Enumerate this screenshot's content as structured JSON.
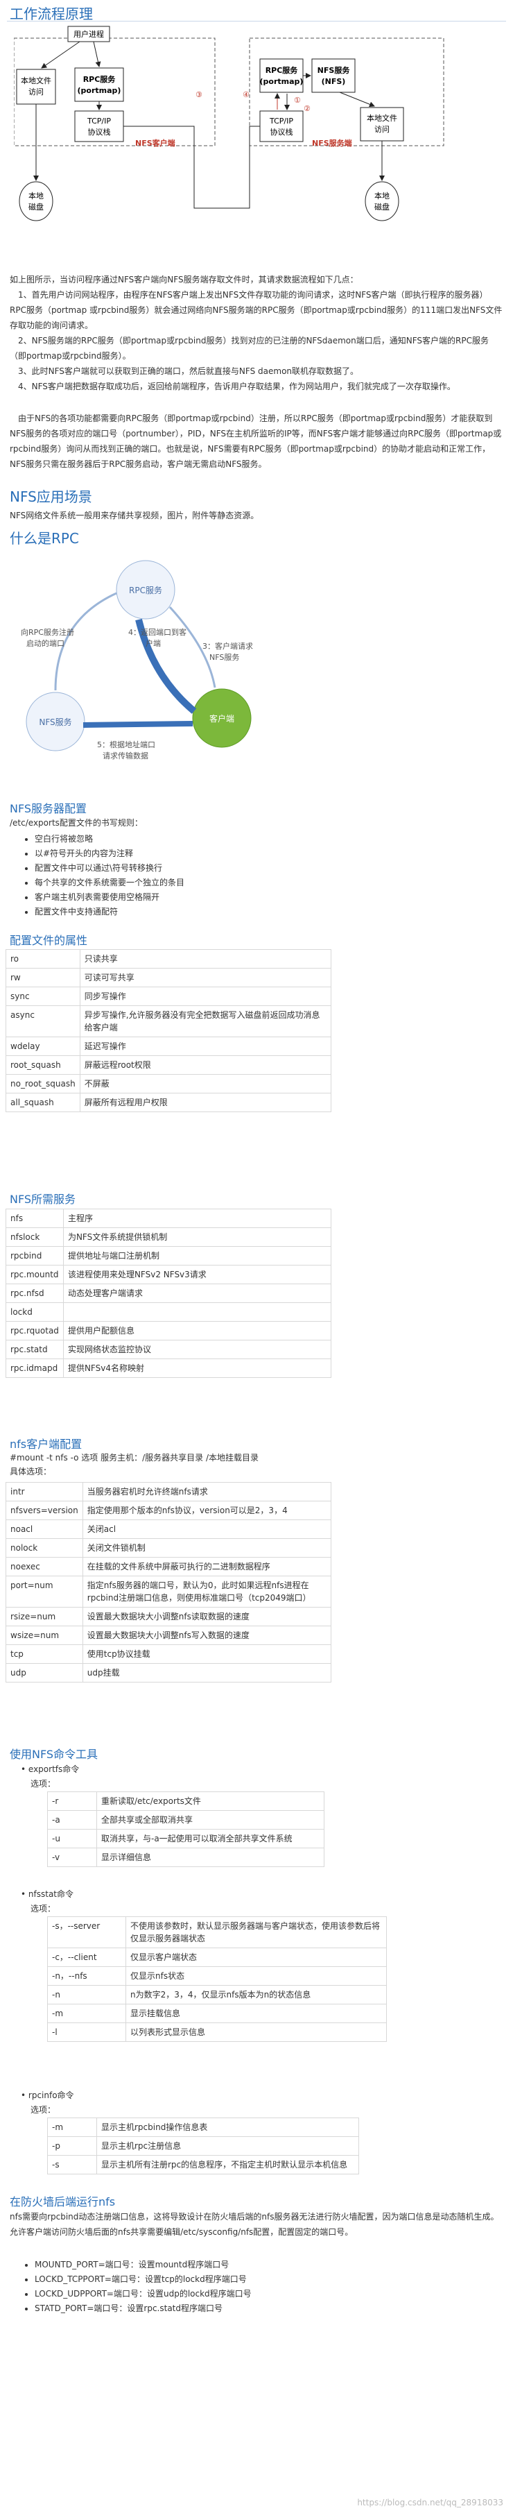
{
  "s1_title": "工作流程原理",
  "diagram": {
    "user_process": "用户进程",
    "local_fs1": "本地文件",
    "local_fs2": "访问",
    "rpc_left1": "RPC服务",
    "rpc_left2": "(portmap)",
    "tcpip_left1": "TCP/IP",
    "tcpip_left2": "协议栈",
    "client_label": "NFS客户端",
    "rpc_right1": "RPC服务",
    "rpc_right2": "(portmap)",
    "nfs_srv1": "NFS服务",
    "nfs_srv2": "(NFS)",
    "tcpip_right1": "TCP/IP",
    "tcpip_right2": "协议栈",
    "local_fs_r1": "本地文件",
    "local_fs_r2": "访问",
    "server_label": "NFS服务端",
    "disk_left1": "本地",
    "disk_left2": "磁盘",
    "disk_right1": "本地",
    "disk_right2": "磁盘",
    "n1": "①",
    "n2": "②",
    "n3": "③",
    "n4": "④"
  },
  "s1_paras": [
    "如上图所示，当访问程序通过NFS客户端向NFS服务端存取文件时，其请求数据流程如下几点：",
    "　1、首先用户访问网站程序，由程序在NFS客户端上发出NFS文件存取功能的询问请求，这时NFS客户端（即执行程序的服务器）RPC服务（portmap 或rpcbind服务）就会通过网络向NFS服务端的RPC服务（即portmap或rpcbind服务）的111端口发出NFS文件存取功能的询问请求。",
    "　2、NFS服务端的RPC服务（即portmap或rpcbind服务）找到对应的已注册的NFSdaemon端口后，通知NFS客户端的RPC服务（即portmap或rpcbind服务）。",
    "　3、此时NFS客户端就可以获取到正确的端口，然后就直接与NFS daemon联机存取数据了。",
    "　4、NFS客户端把数据存取成功后，返回给前端程序，告诉用户存取结果，作为网站用户，我们就完成了一次存取操作。",
    "　由于NFS的各项功能都需要向RPC服务（即portmap或rpcbind）注册，所以RPC服务（即portmap或rpcbind服务）才能获取到NFS服务的各项对应的端口号（portnumber），PID，NFS在主机所监听的IP等，而NFS客户端才能够通过向RPC服务（即portmap或rpcbind服务）询问从而找到正确的端口。也就是说，NFS需要有RPC服务（即portmap或rpcbind）的协助才能启动和正常工作，NFS服务只需在服务器后于RPC服务启动，客户端无需启动NFS服务。"
  ],
  "s2_title": "NFS应用场景",
  "s2_text": "NFS网络文件系统一般用来存储共享视频，图片，附件等静态资源。",
  "s3_title": "什么是RPC",
  "rpc": {
    "rpc_node": "RPC服务",
    "nfs_node": "NFS服务",
    "client_node": "客户端",
    "l1a": "向RPC服务注册",
    "l1b": "启动的端口",
    "l2a": "4：返回端口到客",
    "l2b": "户端",
    "l3a": "3：客户端请求",
    "l3b": "NFS服务",
    "l4a": "5：根据地址端口",
    "l4b": "请求传输数据"
  },
  "s4_title": "NFS服务器配置",
  "s4_intro": "/etc/exports配置文件的书写规则：",
  "s4_rules": [
    "空白行将被忽略",
    "以#符号开头的内容为注释",
    "配置文件中可以通过\\符号转移换行",
    "每个共享的文件系统需要一个独立的条目",
    "客户端主机列表需要使用空格隔开",
    "配置文件中支持通配符"
  ],
  "s5_title": "配置文件的属性",
  "attrs": [
    [
      "ro",
      "只读共享"
    ],
    [
      "rw",
      "可读可写共享"
    ],
    [
      "sync",
      "同步写操作"
    ],
    [
      "async",
      "异步写操作,允许服务器没有完全把数据写入磁盘前返回成功消息给客户端"
    ],
    [
      "wdelay",
      "延迟写操作"
    ],
    [
      "root_squash",
      "屏蔽远程root权限"
    ],
    [
      "no_root_squash",
      "不屏蔽"
    ],
    [
      "all_squash",
      "屏蔽所有远程用户权限"
    ]
  ],
  "s6_title": "NFS所需服务",
  "services": [
    [
      "nfs",
      "主程序"
    ],
    [
      "nfslock",
      "为NFS文件系统提供锁机制"
    ],
    [
      "rpcbind",
      "提供地址与端口注册机制"
    ],
    [
      "rpc.mountd",
      "该进程使用来处理NFSv2 NFSv3请求"
    ],
    [
      "rpc.nfsd",
      "动态处理客户端请求"
    ],
    [
      "lockd",
      ""
    ],
    [
      "rpc.rquotad",
      "提供用户配额信息"
    ],
    [
      "rpc.statd",
      "实现网络状态监控协议"
    ],
    [
      "rpc.idmapd",
      "提供NFSv4名称映射"
    ]
  ],
  "s7_title": "nfs客户端配置",
  "s7_cmd": "#mount -t nfs -o 选项 服务主机：/服务器共享目录 /本地挂载目录",
  "s7_opts_label": "具体选项：",
  "mount_opts": [
    [
      "intr",
      "当服务器宕机时允许终端nfs请求"
    ],
    [
      "nfsvers=version",
      "指定使用那个版本的nfs协议，version可以是2，3，4"
    ],
    [
      "noacl",
      "关闭acl"
    ],
    [
      "nolock",
      "关闭文件锁机制"
    ],
    [
      "noexec",
      "在挂载的文件系统中屏蔽可执行的二进制数据程序"
    ],
    [
      "port=num",
      "指定nfs服务器的端口号，默认为0，此时如果远程nfs进程在rpcbind注册端口信息，则使用标准端口号（tcp2049端口）"
    ],
    [
      "rsize=num",
      "设置最大数据块大小调整nfs读取数据的速度"
    ],
    [
      "wsize=num",
      "设置最大数据块大小调整nfs写入数据的速度"
    ],
    [
      "tcp",
      "使用tcp协议挂载"
    ],
    [
      "udp",
      "udp挂载"
    ]
  ],
  "s8_title": "使用NFS命令工具",
  "exportfs_name": "exportfs命令",
  "exportfs_opt_label": "选项：",
  "exportfs_opts": [
    [
      "-r",
      "重新读取/etc/exports文件"
    ],
    [
      "-a",
      "全部共享或全部取消共享"
    ],
    [
      "-u",
      "取消共享，与-a一起使用可以取消全部共享文件系统"
    ],
    [
      "-v",
      "显示详细信息"
    ]
  ],
  "nfsstat_name": "nfsstat命令",
  "nfsstat_opt_label": "选项：",
  "nfsstat_opts": [
    [
      "-s，--server",
      "不使用该参数时，默认显示服务器端与客户端状态，使用该参数后将仅显示服务器端状态"
    ],
    [
      "-c，--client",
      "仅显示客户端状态"
    ],
    [
      "-n，--nfs",
      "仅显示nfs状态"
    ],
    [
      "-n",
      "n为数字2，3，4，仅显示nfs版本为n的状态信息"
    ],
    [
      "-m",
      "显示挂载信息"
    ],
    [
      "-l",
      "以列表形式显示信息"
    ]
  ],
  "rpcinfo_name": "rpcinfo命令",
  "rpcinfo_opt_label": "选项：",
  "rpcinfo_opts": [
    [
      "-m",
      "显示主机rpcbind操作信息表"
    ],
    [
      "-p",
      "显示主机rpc注册信息"
    ],
    [
      "-s",
      "显示主机所有注册rpc的信息程序，不指定主机时默认显示本机信息"
    ]
  ],
  "s9_title": "在防火墙后端运行nfs",
  "s9_text": "nfs需要向rpcbind动态注册端口信息，这将导致设计在防火墙后端的nfs服务器无法进行防火墙配置，因为端口信息是动态随机生成。允许客户端访问防火墙后面的nfs共享需要编辑/etc/sysconfig/nfs配置，配置固定的端口号。",
  "s9_items": [
    "MOUNTD_PORT=端口号：设置mountd程序端口号",
    "LOCKD_TCPPORT=端口号：设置tcp的lockd程序端口号",
    "LOCKD_UDPPORT=端口号：设置udp的lockd程序端口号",
    "STATD_PORT=端口号：设置rpc.statd程序端口号"
  ],
  "watermark": "https://blog.csdn.net/qq_28918033"
}
